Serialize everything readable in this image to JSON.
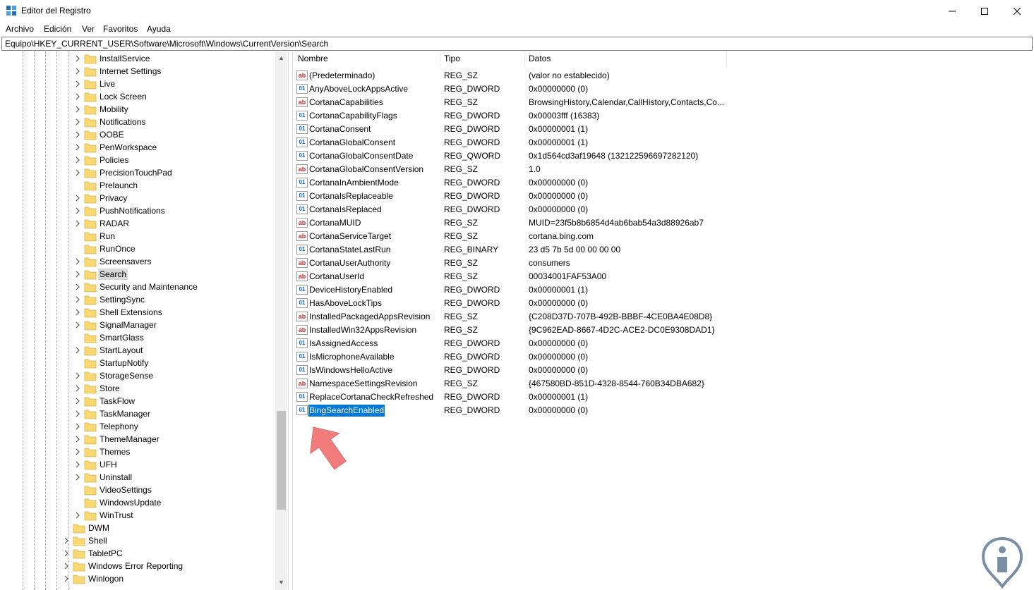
{
  "window": {
    "title": "Editor del Registro",
    "minimize": "—",
    "maximize": "☐",
    "close": "✕"
  },
  "menu": {
    "items": [
      "Archivo",
      "Edición",
      "Ver",
      "Favoritos",
      "Ayuda"
    ]
  },
  "address": {
    "path": "Equipo\\HKEY_CURRENT_USER\\Software\\Microsoft\\Windows\\CurrentVersion\\Search"
  },
  "tree": {
    "items": [
      {
        "label": "InstallService",
        "expander": true
      },
      {
        "label": "Internet Settings",
        "expander": true
      },
      {
        "label": "Live",
        "expander": true
      },
      {
        "label": "Lock Screen",
        "expander": true
      },
      {
        "label": "Mobility",
        "expander": true
      },
      {
        "label": "Notifications",
        "expander": true
      },
      {
        "label": "OOBE",
        "expander": true
      },
      {
        "label": "PenWorkspace",
        "expander": true
      },
      {
        "label": "Policies",
        "expander": true
      },
      {
        "label": "PrecisionTouchPad",
        "expander": true
      },
      {
        "label": "Prelaunch",
        "expander": false
      },
      {
        "label": "Privacy",
        "expander": true
      },
      {
        "label": "PushNotifications",
        "expander": true
      },
      {
        "label": "RADAR",
        "expander": true
      },
      {
        "label": "Run",
        "expander": false
      },
      {
        "label": "RunOnce",
        "expander": false
      },
      {
        "label": "Screensavers",
        "expander": true
      },
      {
        "label": "Search",
        "expander": true,
        "selected": true
      },
      {
        "label": "Security and Maintenance",
        "expander": true
      },
      {
        "label": "SettingSync",
        "expander": true
      },
      {
        "label": "Shell Extensions",
        "expander": true
      },
      {
        "label": "SignalManager",
        "expander": true
      },
      {
        "label": "SmartGlass",
        "expander": false
      },
      {
        "label": "StartLayout",
        "expander": true
      },
      {
        "label": "StartupNotify",
        "expander": false
      },
      {
        "label": "StorageSense",
        "expander": true
      },
      {
        "label": "Store",
        "expander": true
      },
      {
        "label": "TaskFlow",
        "expander": true
      },
      {
        "label": "TaskManager",
        "expander": true
      },
      {
        "label": "Telephony",
        "expander": true
      },
      {
        "label": "ThemeManager",
        "expander": true
      },
      {
        "label": "Themes",
        "expander": true
      },
      {
        "label": "UFH",
        "expander": true
      },
      {
        "label": "Uninstall",
        "expander": true
      },
      {
        "label": "VideoSettings",
        "expander": false
      },
      {
        "label": "WindowsUpdate",
        "expander": false
      },
      {
        "label": "WinTrust",
        "expander": true
      },
      {
        "label": "DWM",
        "expander": false,
        "level": 1
      },
      {
        "label": "Shell",
        "expander": true,
        "level": 1
      },
      {
        "label": "TabletPC",
        "expander": true,
        "level": 1
      },
      {
        "label": "Windows Error Reporting",
        "expander": true,
        "level": 1
      },
      {
        "label": "Winlogon",
        "expander": true,
        "level": 1
      }
    ]
  },
  "list": {
    "columns": [
      "Nombre",
      "Tipo",
      "Datos"
    ],
    "rows": [
      {
        "name": "(Predeterminado)",
        "type": "REG_SZ",
        "data": "(valor no establecido)",
        "icon": "string-value-icon"
      },
      {
        "name": "AnyAboveLockAppsActive",
        "type": "REG_DWORD",
        "data": "0x00000000 (0)",
        "icon": "binary-value-icon"
      },
      {
        "name": "CortanaCapabilities",
        "type": "REG_SZ",
        "data": "BrowsingHistory,Calendar,CallHistory,Contacts,Co...",
        "icon": "string-value-icon"
      },
      {
        "name": "CortanaCapabilityFlags",
        "type": "REG_DWORD",
        "data": "0x00003fff (16383)",
        "icon": "binary-value-icon"
      },
      {
        "name": "CortanaConsent",
        "type": "REG_DWORD",
        "data": "0x00000001 (1)",
        "icon": "binary-value-icon"
      },
      {
        "name": "CortanaGlobalConsent",
        "type": "REG_DWORD",
        "data": "0x00000001 (1)",
        "icon": "binary-value-icon"
      },
      {
        "name": "CortanaGlobalConsentDate",
        "type": "REG_QWORD",
        "data": "0x1d564cd3af19648 (132122596697282120)",
        "icon": "binary-value-icon"
      },
      {
        "name": "CortanaGlobalConsentVersion",
        "type": "REG_SZ",
        "data": "1.0",
        "icon": "string-value-icon"
      },
      {
        "name": "CortanaInAmbientMode",
        "type": "REG_DWORD",
        "data": "0x00000000 (0)",
        "icon": "binary-value-icon"
      },
      {
        "name": "CortanaIsReplaceable",
        "type": "REG_DWORD",
        "data": "0x00000000 (0)",
        "icon": "binary-value-icon"
      },
      {
        "name": "CortanaIsReplaced",
        "type": "REG_DWORD",
        "data": "0x00000000 (0)",
        "icon": "binary-value-icon"
      },
      {
        "name": "CortanaMUID",
        "type": "REG_SZ",
        "data": "MUID=23f5b8b6854d4ab6bab54a3d88926ab7",
        "icon": "string-value-icon"
      },
      {
        "name": "CortanaServiceTarget",
        "type": "REG_SZ",
        "data": "cortana.bing.com",
        "icon": "string-value-icon"
      },
      {
        "name": "CortanaStateLastRun",
        "type": "REG_BINARY",
        "data": "23 d5 7b 5d 00 00 00 00",
        "icon": "binary-value-icon"
      },
      {
        "name": "CortanaUserAuthority",
        "type": "REG_SZ",
        "data": "consumers",
        "icon": "string-value-icon"
      },
      {
        "name": "CortanaUserId",
        "type": "REG_SZ",
        "data": "00034001FAF53A00",
        "icon": "string-value-icon"
      },
      {
        "name": "DeviceHistoryEnabled",
        "type": "REG_DWORD",
        "data": "0x00000001 (1)",
        "icon": "binary-value-icon"
      },
      {
        "name": "HasAboveLockTips",
        "type": "REG_DWORD",
        "data": "0x00000000 (0)",
        "icon": "binary-value-icon"
      },
      {
        "name": "InstalledPackagedAppsRevision",
        "type": "REG_SZ",
        "data": "{C208D37D-707B-492B-BBBF-4CE0BA4E08D8}",
        "icon": "string-value-icon"
      },
      {
        "name": "InstalledWin32AppsRevision",
        "type": "REG_SZ",
        "data": "{9C962EAD-8667-4D2C-ACE2-DC0E9308DAD1}",
        "icon": "string-value-icon"
      },
      {
        "name": "IsAssignedAccess",
        "type": "REG_DWORD",
        "data": "0x00000000 (0)",
        "icon": "binary-value-icon"
      },
      {
        "name": "IsMicrophoneAvailable",
        "type": "REG_DWORD",
        "data": "0x00000000 (0)",
        "icon": "binary-value-icon"
      },
      {
        "name": "IsWindowsHelloActive",
        "type": "REG_DWORD",
        "data": "0x00000000 (0)",
        "icon": "binary-value-icon"
      },
      {
        "name": "NamespaceSettingsRevision",
        "type": "REG_SZ",
        "data": "{467580BD-851D-4328-8544-760B34DBA682}",
        "icon": "string-value-icon"
      },
      {
        "name": "ReplaceCortanaCheckRefreshed",
        "type": "REG_DWORD",
        "data": "0x00000001 (1)",
        "icon": "binary-value-icon"
      },
      {
        "name": "BingSearchEnabled",
        "type": "REG_DWORD",
        "data": "0x00000000 (0)",
        "icon": "binary-value-icon",
        "selected": true
      }
    ]
  },
  "colors": {
    "selection": "#0078d7",
    "folder": "#f8d775",
    "annotation_arrow": "#f07c7c",
    "string_icon": "#c4332f",
    "binary_icon": "#1f5fb4"
  }
}
